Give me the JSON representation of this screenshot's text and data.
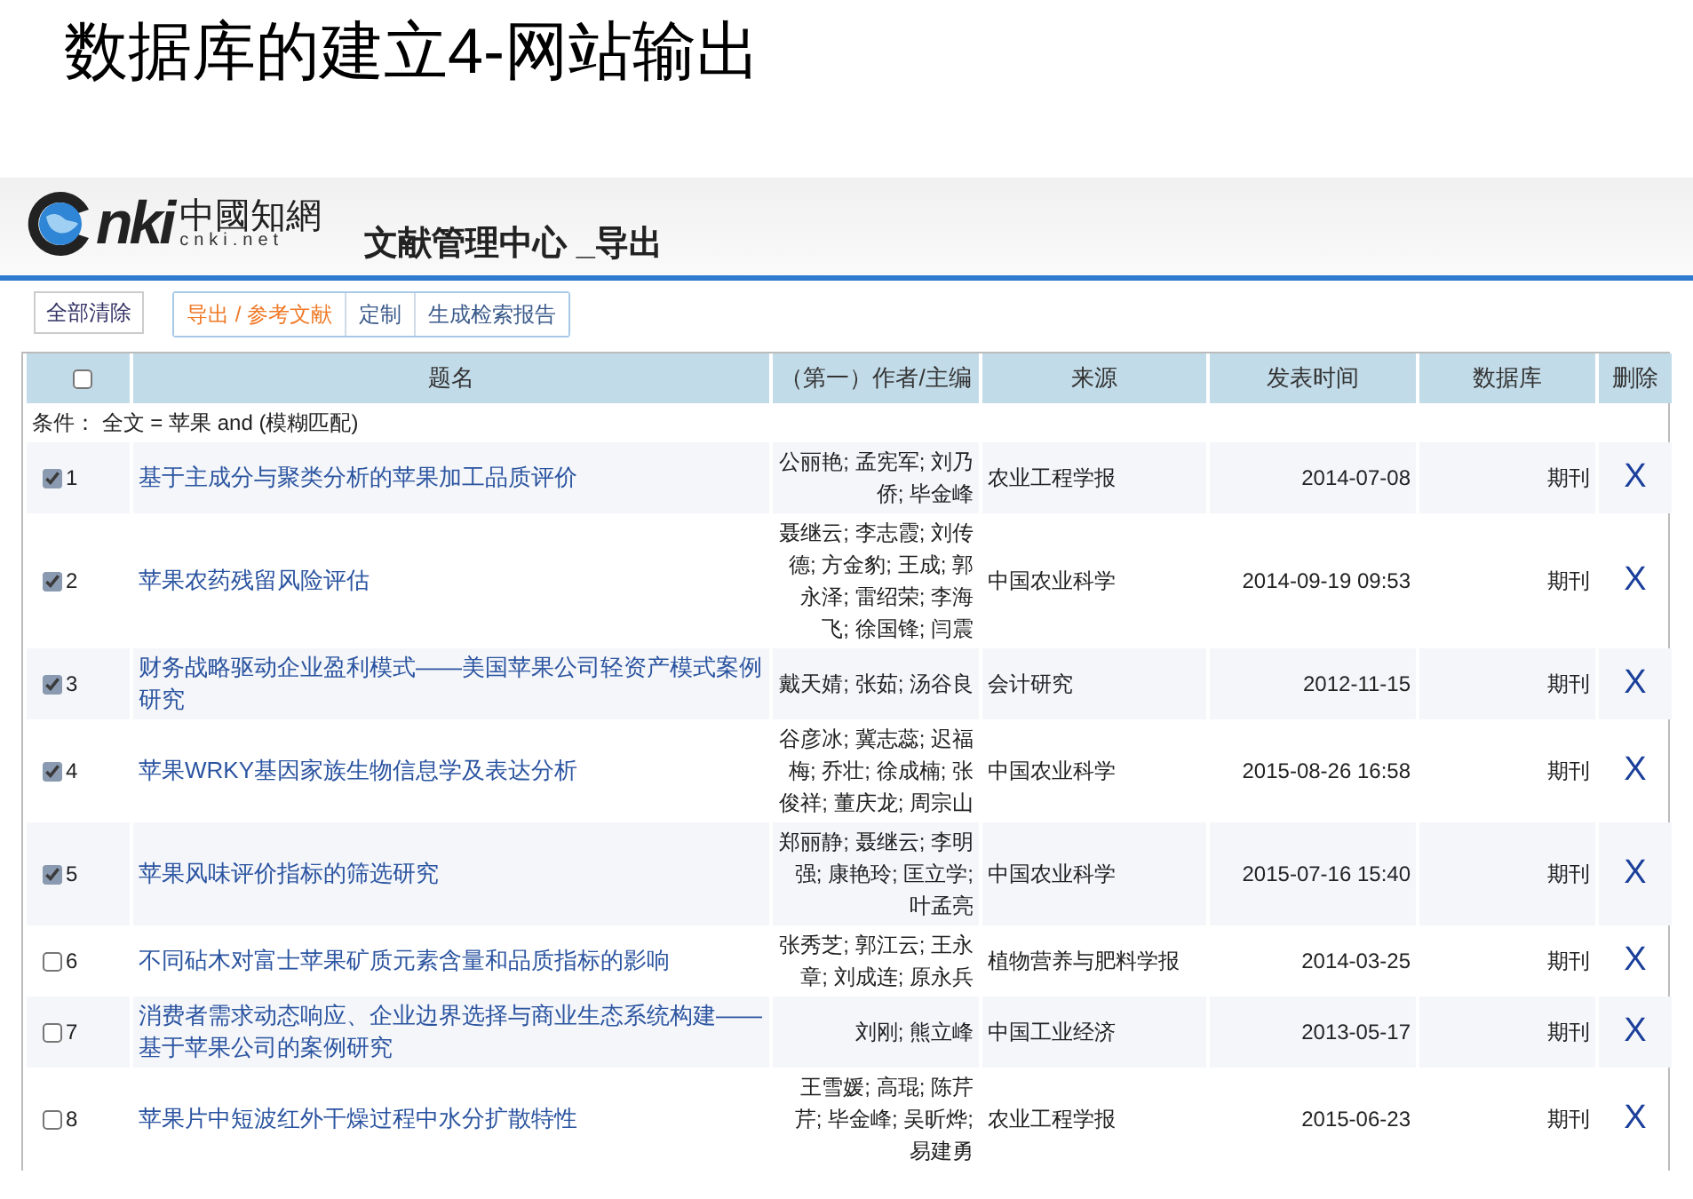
{
  "slide_title": "数据库的建立4-网站输出",
  "header": {
    "logo": {
      "mark": "nki",
      "name_cn": "中國知網",
      "domain": "cnki.net"
    },
    "title": "文献管理中心 _导出"
  },
  "toolbar": {
    "clear_button": "全部清除",
    "tabs": [
      {
        "label": "导出 / 参考文献",
        "selected": true
      },
      {
        "label": "定制",
        "selected": false
      },
      {
        "label": "生成检索报告",
        "selected": false
      }
    ]
  },
  "table": {
    "select_all": {
      "checked": false
    },
    "columns": [
      "题名",
      "（第一）作者/主编",
      "来源",
      "发表时间",
      "数据库",
      "删除"
    ],
    "condition": "条件： 全文 = 苹果 and (模糊匹配)",
    "rows": [
      {
        "checked": true,
        "number": "1",
        "title": "基于主成分与聚类分析的苹果加工品质评价",
        "authors": "公丽艳; 孟宪军; 刘乃侨; 毕金峰",
        "source": "农业工程学报",
        "date": "2014-07-08",
        "database": "期刊",
        "delete": "X"
      },
      {
        "checked": true,
        "number": "2",
        "title": "苹果农药残留风险评估",
        "authors": "聂继云; 李志霞; 刘传德; 方金豹; 王成; 郭永泽; 雷绍荣; 李海飞; 徐国锋; 闫震",
        "source": "中国农业科学",
        "date": "2014-09-19 09:53",
        "database": "期刊",
        "delete": "X"
      },
      {
        "checked": true,
        "number": "3",
        "title": "财务战略驱动企业盈利模式——美国苹果公司轻资产模式案例研究",
        "authors": "戴天婧; 张茹; 汤谷良",
        "source": "会计研究",
        "date": "2012-11-15",
        "database": "期刊",
        "delete": "X"
      },
      {
        "checked": true,
        "number": "4",
        "title": "苹果WRKY基因家族生物信息学及表达分析",
        "authors": "谷彦冰; 冀志蕊; 迟福梅; 乔壮; 徐成楠; 张俊祥; 董庆龙; 周宗山",
        "source": "中国农业科学",
        "date": "2015-08-26 16:58",
        "database": "期刊",
        "delete": "X"
      },
      {
        "checked": true,
        "number": "5",
        "title": "苹果风味评价指标的筛选研究",
        "authors": "郑丽静; 聂继云; 李明强; 康艳玲; 匡立学; 叶孟亮",
        "source": "中国农业科学",
        "date": "2015-07-16 15:40",
        "database": "期刊",
        "delete": "X"
      },
      {
        "checked": false,
        "number": "6",
        "title": "不同砧木对富士苹果矿质元素含量和品质指标的影响",
        "authors": "张秀芝; 郭江云; 王永章; 刘成连; 原永兵",
        "source": "植物营养与肥料学报",
        "date": "2014-03-25",
        "database": "期刊",
        "delete": "X"
      },
      {
        "checked": false,
        "number": "7",
        "title": "消费者需求动态响应、企业边界选择与商业生态系统构建——基于苹果公司的案例研究",
        "authors": "刘刚; 熊立峰",
        "source": "中国工业经济",
        "date": "2013-05-17",
        "database": "期刊",
        "delete": "X"
      },
      {
        "checked": false,
        "number": "8",
        "title": "苹果片中短波红外干燥过程中水分扩散特性",
        "authors": "王雪媛; 高琨; 陈芹芹; 毕金峰; 吴昕烨; 易建勇",
        "source": "农业工程学报",
        "date": "2015-06-23",
        "database": "期刊",
        "delete": "X"
      }
    ]
  }
}
